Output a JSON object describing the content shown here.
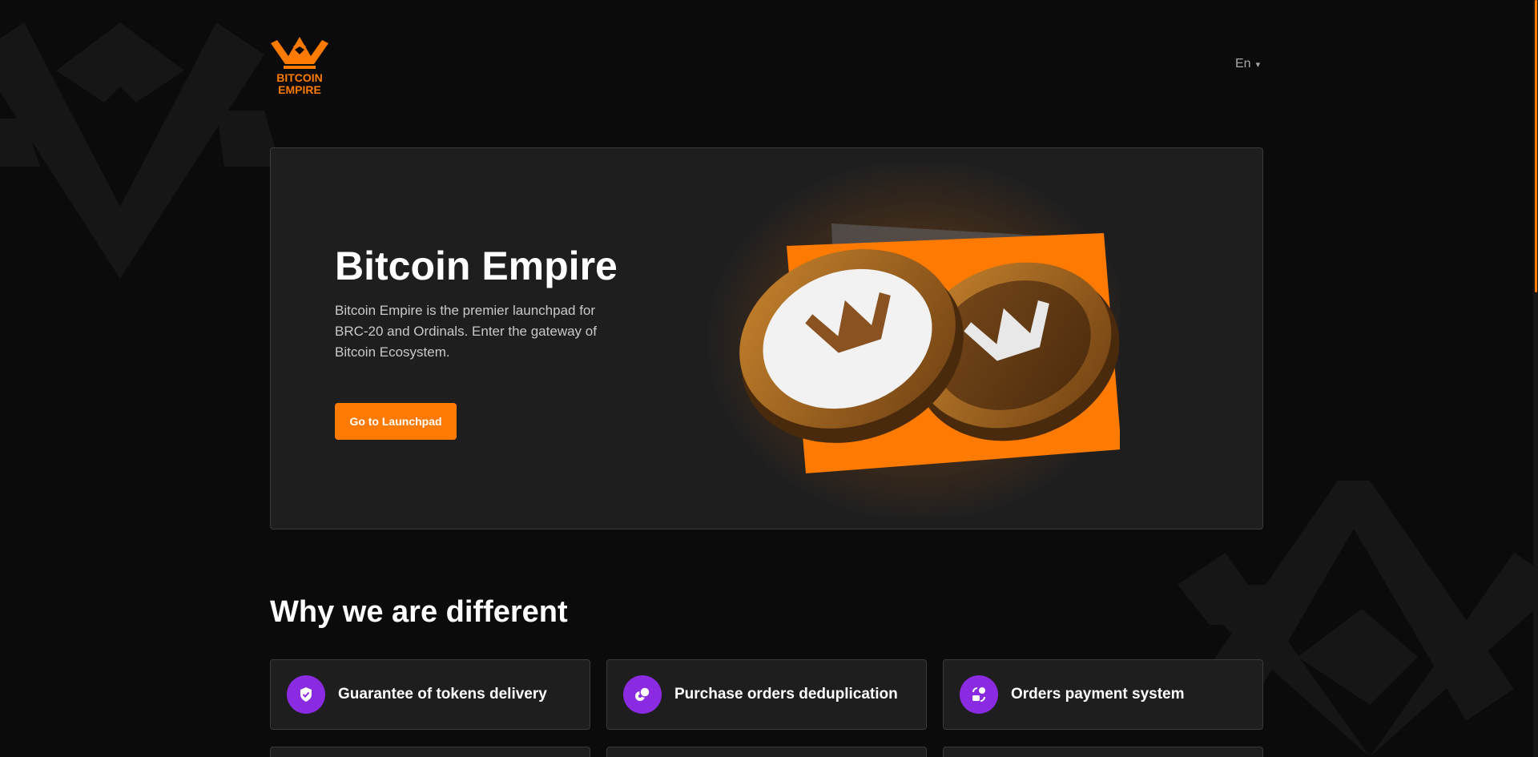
{
  "brand": {
    "logo_line1": "BITCOIN",
    "logo_line2": "EMPIRE",
    "accent_color": "#ff7a00",
    "feature_icon_color": "#8a2be2"
  },
  "header": {
    "language": "En",
    "language_caret": "▾"
  },
  "hero": {
    "title": "Bitcoin Empire",
    "description": "Bitcoin Empire is the premier launchpad for BRC-20 and Ordinals. Enter the gateway of Bitcoin Ecosystem.",
    "cta_label": "Go to Launchpad"
  },
  "features": {
    "title": "Why we are different",
    "items": [
      {
        "label": "Guarantee of tokens delivery",
        "icon": "shield-check-icon"
      },
      {
        "label": "Purchase orders deduplication",
        "icon": "coins-icon"
      },
      {
        "label": "Orders payment system",
        "icon": "payment-swap-icon"
      }
    ]
  }
}
